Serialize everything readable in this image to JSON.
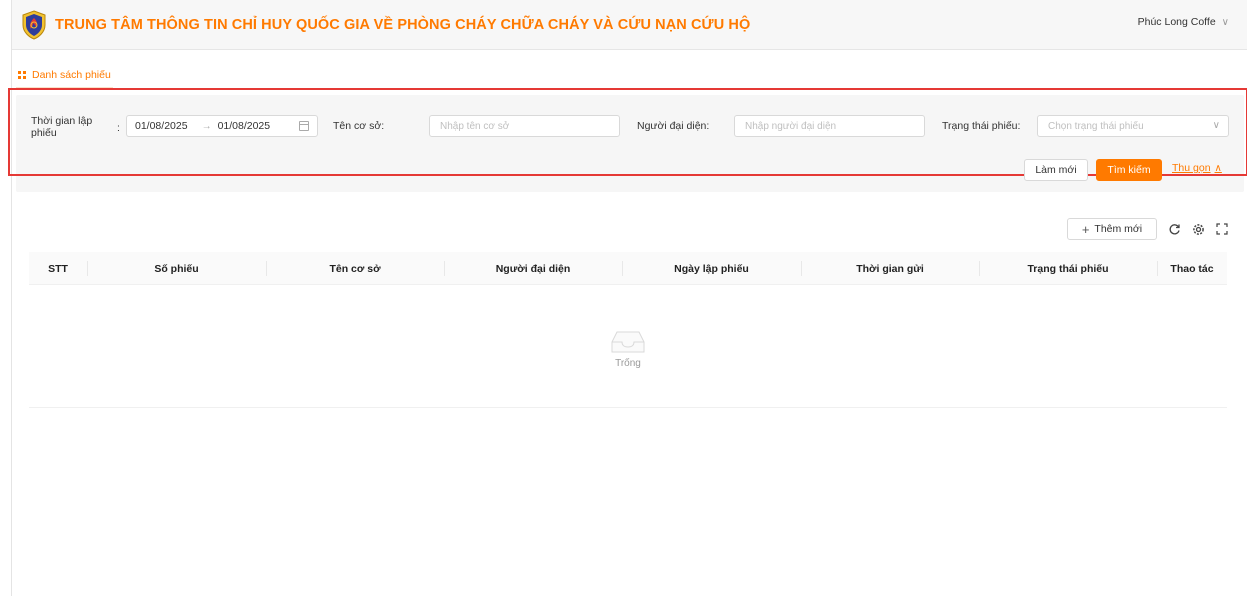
{
  "header": {
    "title": "TRUNG TÂM THÔNG TIN CHỈ HUY QUỐC GIA VỀ PHÒNG CHÁY CHỮA CHÁY VÀ CỨU NẠN CỨU HỘ",
    "user_name": "Phúc Long Coffe",
    "user_chevron": "chevron-down-icon"
  },
  "tabs": [
    {
      "label": "Danh sách phiếu",
      "icon": "grid-icon",
      "active": true
    }
  ],
  "filters": {
    "date_label": "Thời gian lập phiếu",
    "date_colon": ":",
    "date_from": "01/08/2025",
    "date_to": "01/08/2025",
    "date_arrow": "→",
    "facility_label": "Tên cơ sở:",
    "facility_placeholder": "Nhập tên cơ sở",
    "representative_label": "Người đại diện:",
    "representative_placeholder": "Nhập người đại diện",
    "status_label": "Trạng thái phiếu:",
    "status_placeholder": "Chọn trạng thái phiếu",
    "reset_label": "Làm mới",
    "search_label": "Tìm kiếm",
    "collapse_label": "Thu gọn"
  },
  "toolbar": {
    "add_label": "Thêm mới",
    "add_icon": "plus-icon",
    "refresh_icon": "refresh-icon",
    "settings_icon": "settings-icon",
    "fullscreen_icon": "fullscreen-icon"
  },
  "table": {
    "columns": [
      "STT",
      "Số phiếu",
      "Tên cơ sở",
      "Người đại diện",
      "Ngày lập phiếu",
      "Thời gian gửi",
      "Trạng thái phiếu",
      "Thao tác"
    ],
    "rows": [],
    "empty_text": "Trống"
  },
  "colors": {
    "accent": "#ff7a00",
    "highlight_border": "#e53935"
  }
}
